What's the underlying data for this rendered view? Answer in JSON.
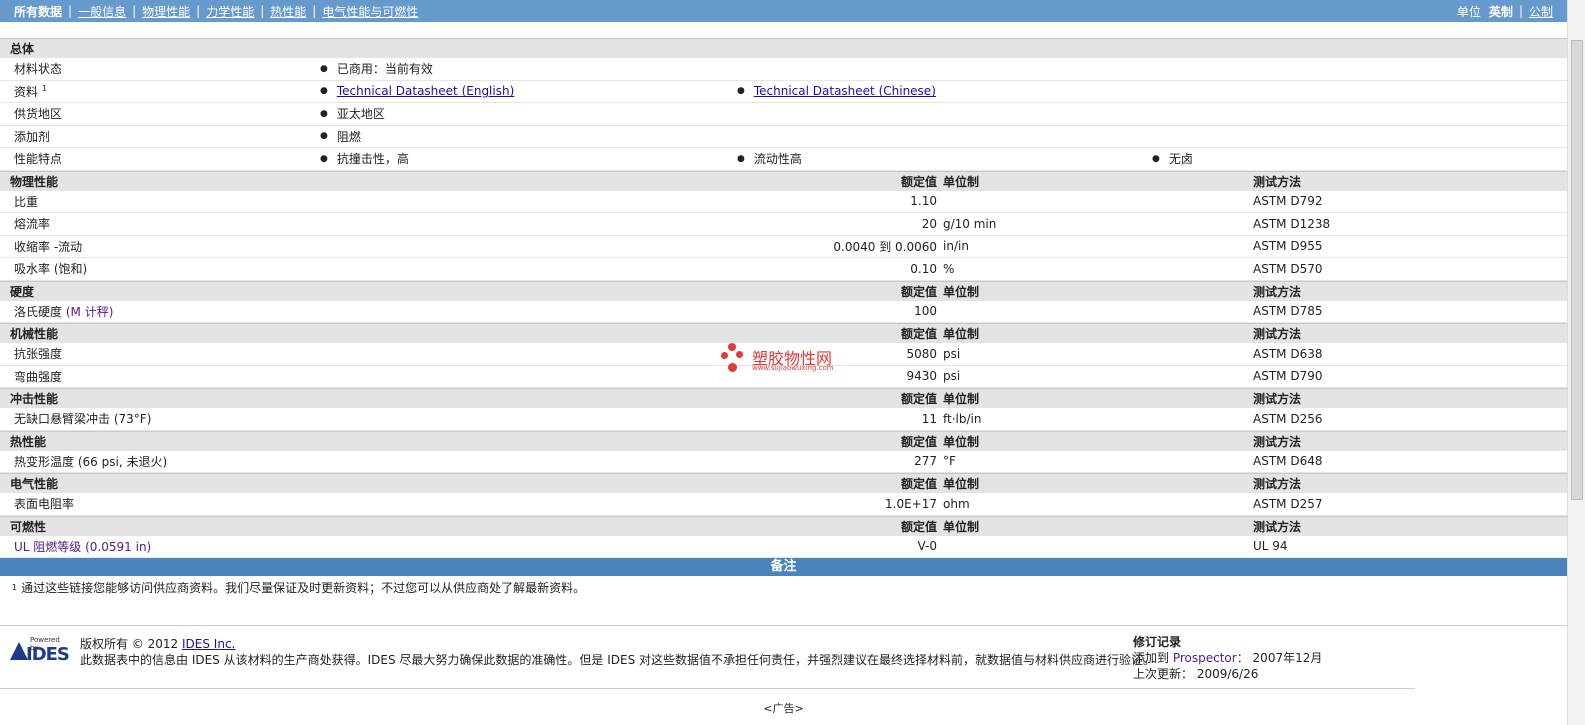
{
  "nav": {
    "items": [
      "所有数据",
      "一般信息",
      "物理性能",
      "力学性能",
      "热性能",
      "电气性能与可燃性"
    ],
    "units_label": "单位",
    "unit_options": [
      "英制",
      "公制"
    ]
  },
  "general": {
    "title": "总体",
    "material_status": {
      "label": "材料状态",
      "value": "已商用：当前有效"
    },
    "docs": {
      "label": "资料",
      "sup": "1",
      "links": [
        "Technical Datasheet (English)",
        "Technical Datasheet (Chinese)"
      ]
    },
    "region": {
      "label": "供货地区",
      "value": "亚太地区"
    },
    "additive": {
      "label": "添加剂",
      "value": "阻燃"
    },
    "features": {
      "label": "性能特点",
      "values": [
        "抗撞击性，高",
        "流动性高",
        "无卤"
      ]
    }
  },
  "headers": {
    "nominal": "额定值",
    "unit": "单位制",
    "test": "测试方法"
  },
  "physical": {
    "title": "物理性能",
    "rows": [
      {
        "prop": "比重",
        "val": "1.10",
        "unit": "",
        "test": "ASTM D792"
      },
      {
        "prop": "熔流率",
        "val": "20",
        "unit": "g/10 min",
        "test": "ASTM D1238"
      },
      {
        "prop": "收缩率 -流动",
        "val": "0.0040 到  0.0060",
        "unit": "in/in",
        "test": "ASTM D955"
      },
      {
        "prop": "吸水率 (饱和)",
        "val": "0.10",
        "unit": "%",
        "test": "ASTM D570"
      }
    ]
  },
  "hardness": {
    "title": "硬度",
    "rows": [
      {
        "prop": "洛氏硬度",
        "note": "(M 计秤)",
        "val": "100",
        "unit": "",
        "test": "ASTM D785"
      }
    ]
  },
  "mechanical": {
    "title": "机械性能",
    "rows": [
      {
        "prop": "抗张强度",
        "val": "5080",
        "unit": "psi",
        "test": "ASTM D638"
      },
      {
        "prop": "弯曲强度",
        "val": "9430",
        "unit": "psi",
        "test": "ASTM D790"
      }
    ]
  },
  "impact": {
    "title": "冲击性能",
    "rows": [
      {
        "prop": "无缺口悬臂梁冲击",
        "note": "(73°F)",
        "val": "11",
        "unit": "ft·lb/in",
        "test": "ASTM D256"
      }
    ]
  },
  "thermal": {
    "title": "热性能",
    "rows": [
      {
        "prop": "热变形温度",
        "note": "(66 psi, 未退火)",
        "val": "277",
        "unit": "°F",
        "test": "ASTM D648"
      }
    ]
  },
  "electrical": {
    "title": "电气性能",
    "rows": [
      {
        "prop": "表面电阻率",
        "val": "1.0E+17",
        "unit": "ohm",
        "test": "ASTM D257"
      }
    ]
  },
  "flammability": {
    "title": "可燃性",
    "rows": [
      {
        "prop": "UL 阻燃等级",
        "note": "(0.0591 in)",
        "val": "V-0",
        "unit": "",
        "test": "UL 94"
      }
    ]
  },
  "notes": {
    "title": "备注",
    "sup": "1",
    "text": "通过这些链接您能够访问供应商资料。我们尽量保证及时更新资料；不过您可以从供应商处了解最新资料。"
  },
  "footer": {
    "logo_powered": "Powered by",
    "logo_text": "IDES",
    "copyright": "版权所有 © 2012",
    "company": "IDES Inc.",
    "disclaimer": "此数据表中的信息由 IDES 从该材料的生产商处获得。IDES 尽最大努力确保此数据的准确性。但是 IDES 对这些数据值不承担任何责任，并强烈建议在最终选择材料前，就数据值与材料供应商进行验证。",
    "revision_title": "修订记录",
    "added_label": "添加到",
    "added_where": "Prospector：",
    "added_date": "2007年12月",
    "updated_label": "上次更新：",
    "updated_date": "2009/6/26",
    "ad": "<广告>"
  },
  "watermark": {
    "name": "塑胶物性网",
    "url": "www.sujiaowuxing.com"
  },
  "colors": {
    "nav_bar": "#6699cc",
    "section_bg": "#e3e3e3",
    "notes_bar": "#4a84bd",
    "watermark": "#e53935"
  }
}
